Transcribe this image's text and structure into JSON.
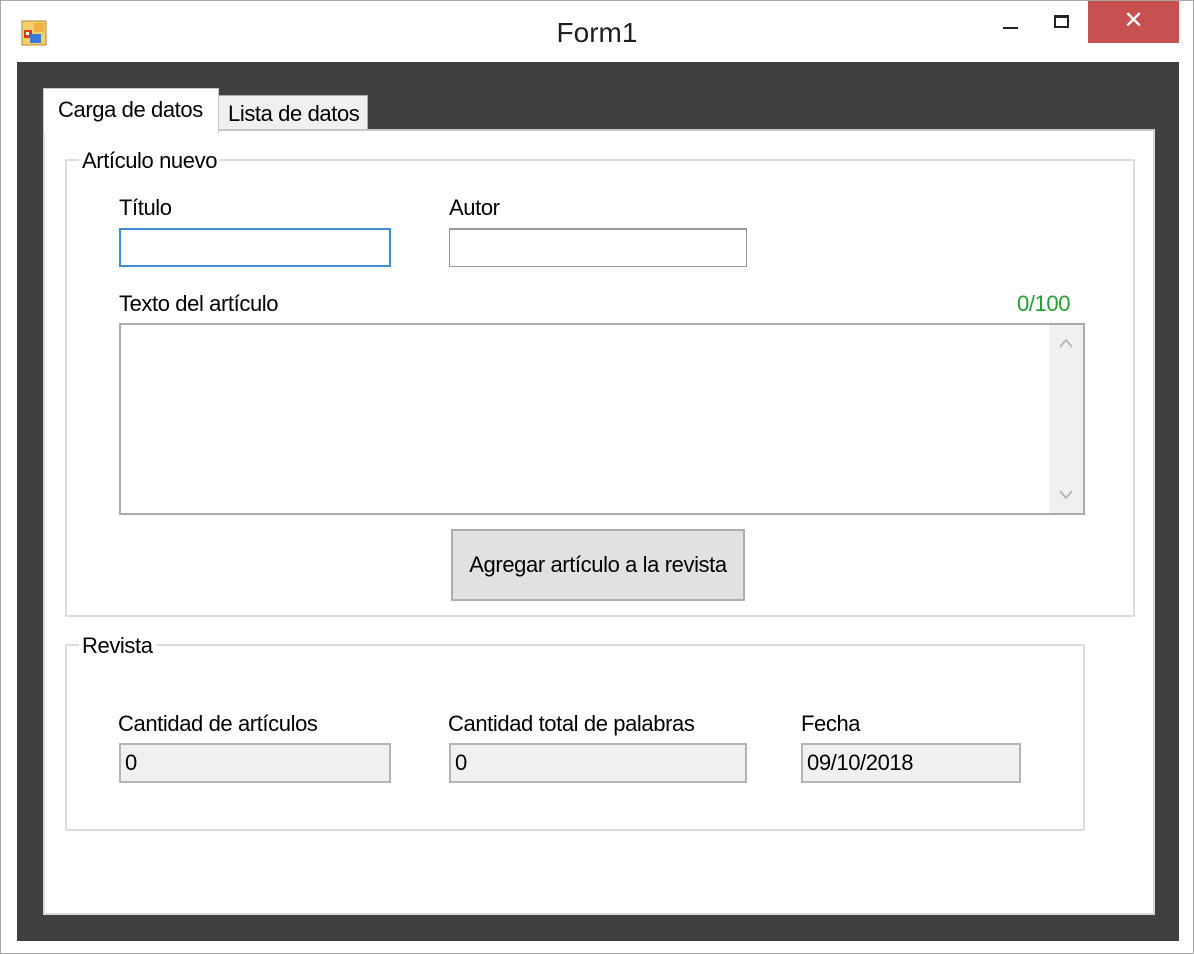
{
  "window": {
    "title": "Form1",
    "close_glyph": "✕"
  },
  "tabs": [
    {
      "label": "Carga de datos",
      "active": true
    },
    {
      "label": "Lista de datos",
      "active": false
    }
  ],
  "articulo": {
    "legend": "Artículo nuevo",
    "titulo_label": "Título",
    "titulo_value": "",
    "autor_label": "Autor",
    "autor_value": "",
    "texto_label": "Texto del artículo",
    "texto_value": "",
    "char_counter": "0/100",
    "add_button": "Agregar artículo a la revista"
  },
  "revista": {
    "legend": "Revista",
    "cantidad_articulos_label": "Cantidad de artículos",
    "cantidad_articulos_value": "0",
    "cantidad_palabras_label": "Cantidad total de palabras",
    "cantidad_palabras_value": "0",
    "fecha_label": "Fecha",
    "fecha_value": "09/10/2018"
  },
  "colors": {
    "counter": "#23a233",
    "close_button": "#c75050",
    "frame": "#404040",
    "focus_border": "#3c8fd5"
  },
  "icons": {
    "app": "app-window-icon",
    "minimize": "minimize-icon",
    "maximize": "maximize-icon",
    "close": "close-icon",
    "scroll_up": "chevron-up-icon",
    "scroll_down": "chevron-down-icon"
  }
}
